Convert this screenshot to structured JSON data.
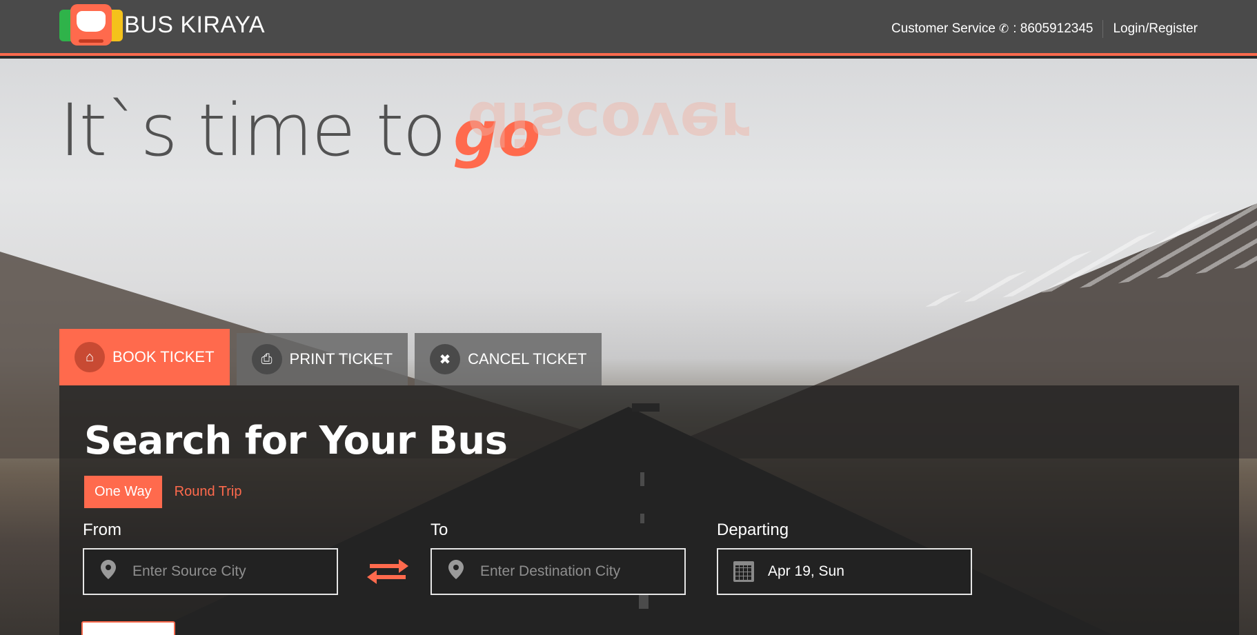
{
  "brand": {
    "name": "BUS KIRAYA"
  },
  "nav": {
    "customer_service_label": "Customer Service",
    "phone_icon": "phone-icon",
    "phone_number": ": 8605912345",
    "login_label": "Login/Register"
  },
  "hero": {
    "headline": "It`s time to",
    "headline_accent": "go",
    "headline_ghost": "discover"
  },
  "tabs": [
    {
      "label": "BOOK TICKET",
      "icon": "home-icon",
      "active": true
    },
    {
      "label": "PRINT TICKET",
      "icon": "printer-icon",
      "active": false
    },
    {
      "label": "CANCEL TICKET",
      "icon": "close-icon",
      "active": false
    }
  ],
  "search": {
    "title": "Search for Your Bus",
    "trip_types": [
      {
        "label": "One Way",
        "active": true
      },
      {
        "label": "Round Trip",
        "active": false
      }
    ],
    "from": {
      "label": "From",
      "placeholder": "Enter Source City",
      "icon": "map-marker-icon"
    },
    "to": {
      "label": "To",
      "placeholder": "Enter Destination City",
      "icon": "map-marker-icon"
    },
    "departing": {
      "label": "Departing",
      "value": "Apr 19, Sun",
      "icon": "calendar-icon"
    }
  },
  "colors": {
    "accent": "#ff6a4d",
    "topbar": "#4a4a4a",
    "panel": "#1e1e1e"
  }
}
